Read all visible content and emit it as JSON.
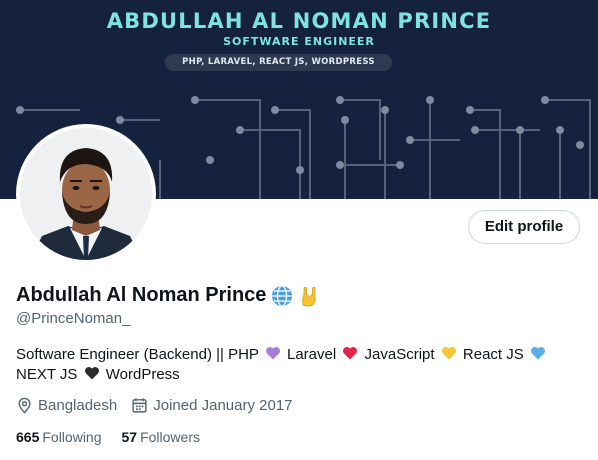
{
  "banner": {
    "title": "ABDULLAH AL NOMAN PRINCE",
    "subtitle": "SOFTWARE ENGINEER",
    "skills": "PHP, LARAVEL, REACT JS, WORDPRESS"
  },
  "profile": {
    "name": "Abdullah Al Noman Prince",
    "handle": "@PrinceNoman_",
    "edit_label": "Edit profile",
    "bio": {
      "seg1": "Software Engineer (Backend) || PHP",
      "seg2": "Laravel",
      "seg3": "JavaScript",
      "seg4": "React JS",
      "seg5": "NEXT JS",
      "seg6": "WordPress"
    },
    "location": "Bangladesh",
    "joined": "Joined January 2017",
    "following_count": "665",
    "following_label": "Following",
    "followers_count": "57",
    "followers_label": "Followers"
  },
  "icons": {
    "name_emoji_1": "globe-icon",
    "name_emoji_2": "rock-hand-icon",
    "location": "location-pin-icon",
    "calendar": "calendar-icon"
  },
  "colors": {
    "banner_bg": "#14213f",
    "banner_accent": "#7fe3e3",
    "heart_purple": "#a67dd4",
    "heart_red": "#e0244a",
    "heart_yellow": "#f6c634",
    "heart_blue": "#5aade6",
    "heart_black": "#2b2b2b"
  }
}
